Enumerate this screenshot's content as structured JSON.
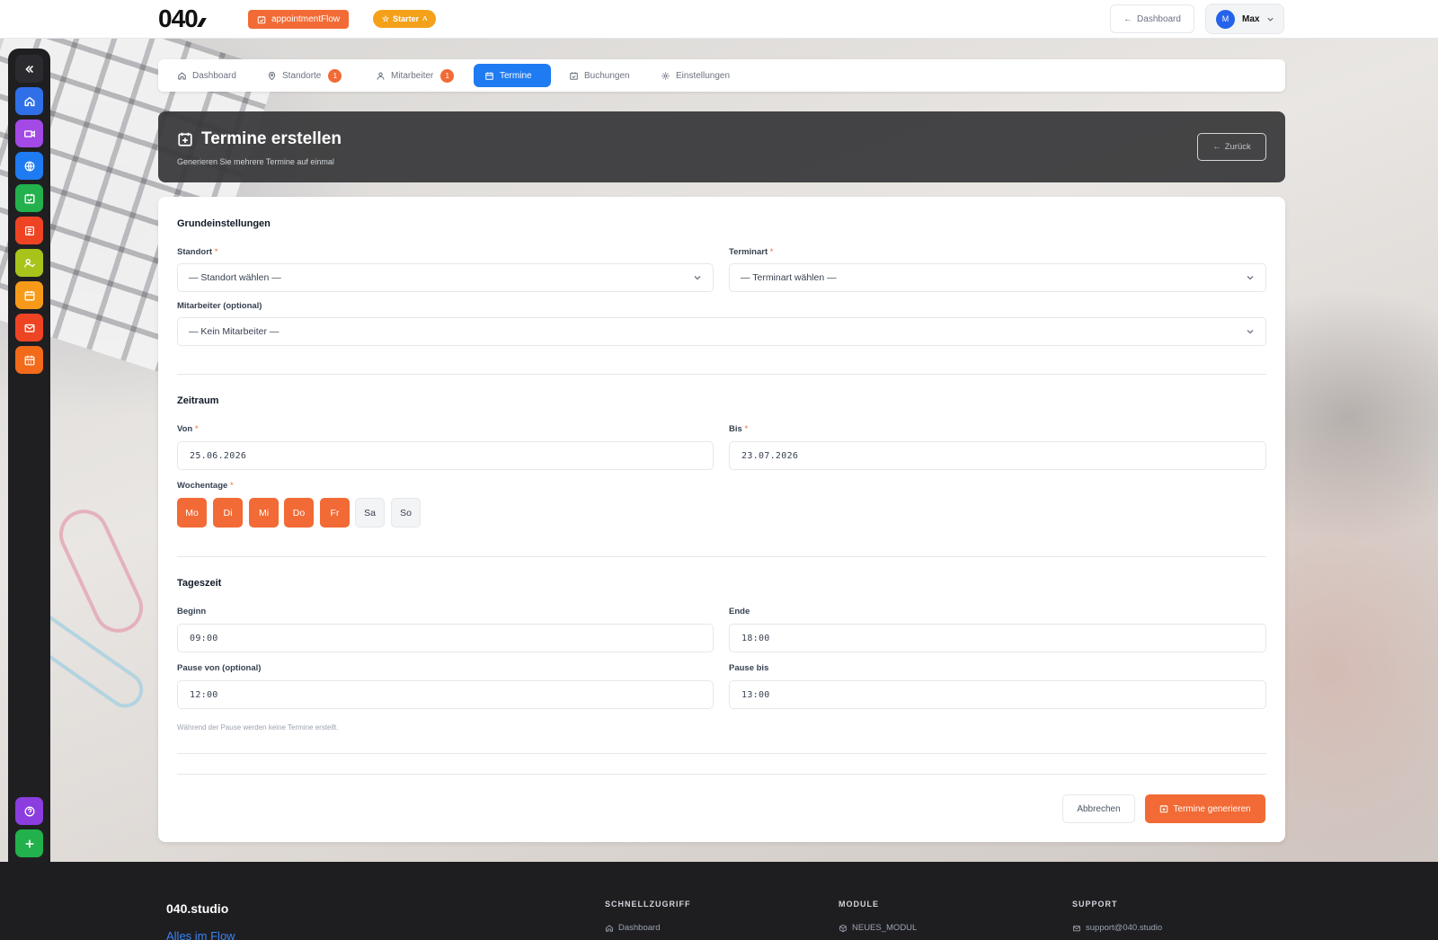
{
  "topbar": {
    "logo": "040",
    "app_badge": "appointmentFlow",
    "plan_badge": "Starter",
    "dashboard_button": "Dashboard",
    "user_initial": "M",
    "user_name": "Max"
  },
  "dock": {
    "items": [
      {
        "icon": "collapse-icon",
        "color": "#1f1f22"
      },
      {
        "icon": "home-icon",
        "color": "#2f6fe8"
      },
      {
        "icon": "video-icon",
        "color": "#a349e6"
      },
      {
        "icon": "globe-icon",
        "color": "#1e7bf2"
      },
      {
        "icon": "calendar-check-icon",
        "color": "#22b14c"
      },
      {
        "icon": "newspaper-icon",
        "color": "#ef4424"
      },
      {
        "icon": "user-check-icon",
        "color": "#a8c41b"
      },
      {
        "icon": "calendar-icon",
        "color": "#f79a1a"
      },
      {
        "icon": "mail-icon",
        "color": "#ef4424"
      },
      {
        "icon": "calendar-grid-icon",
        "color": "#f26a1a"
      }
    ],
    "bottom": [
      {
        "icon": "help-icon",
        "color": "#8b3de0"
      },
      {
        "icon": "plus-icon",
        "color": "#22b14c"
      },
      {
        "icon": "settings-icon",
        "color": "#2f6fe8"
      }
    ]
  },
  "tabs": [
    {
      "label": "Dashboard",
      "icon": "home-icon",
      "count": ""
    },
    {
      "label": "Standorte",
      "icon": "map-pin-icon",
      "count": "1"
    },
    {
      "label": "Mitarbeiter",
      "icon": "user-icon",
      "count": "1"
    },
    {
      "label": "Termine",
      "icon": "calendar-icon",
      "count": "",
      "active": true
    },
    {
      "label": "Buchungen",
      "icon": "calendar-check-icon",
      "count": ""
    },
    {
      "label": "Einstellungen",
      "icon": "gear-icon",
      "count": ""
    }
  ],
  "header": {
    "title": "Termine erstellen",
    "subtitle": "Generieren Sie mehrere Termine auf einmal",
    "back_button": "Zurück"
  },
  "form": {
    "basic": {
      "title": "Grundeinstellungen",
      "location_label": "Standort",
      "location_value": "— Standort wählen —",
      "type_label": "Terminart",
      "type_value": "— Terminart wählen —",
      "staff_label": "Mitarbeiter (optional)",
      "staff_value": "— Kein Mitarbeiter —"
    },
    "period": {
      "title": "Zeitraum",
      "from_label": "Von",
      "from_value": "25.06.2026",
      "to_label": "Bis",
      "to_value": "23.07.2026",
      "weekdays_label": "Wochentage",
      "weekdays": [
        {
          "label": "Mo",
          "selected": true
        },
        {
          "label": "Di",
          "selected": true
        },
        {
          "label": "Mi",
          "selected": true
        },
        {
          "label": "Do",
          "selected": true
        },
        {
          "label": "Fr",
          "selected": true
        },
        {
          "label": "Sa",
          "selected": false
        },
        {
          "label": "So",
          "selected": false
        }
      ]
    },
    "daytime": {
      "title": "Tageszeit",
      "start_label": "Beginn",
      "start_value": "09:00",
      "end_label": "Ende",
      "end_value": "18:00",
      "pause_from_label": "Pause von (optional)",
      "pause_from_value": "12:00",
      "pause_to_label": "Pause bis",
      "pause_to_value": "13:00",
      "hint": "Während der Pause werden keine Termine erstellt."
    },
    "cancel_button": "Abbrechen",
    "generate_button": "Termine generieren",
    "required_mark": "*"
  },
  "footer": {
    "brand": "040.studio",
    "tagline": "Alles im Flow",
    "quick_title": "SCHNELLZUGRIFF",
    "quick_link": "Dashboard",
    "modules_title": "MODULE",
    "modules_link": "NEUES_MODUL",
    "support_title": "SUPPORT",
    "support_link": "support@040.studio"
  },
  "colors": {
    "accent": "#f26a35",
    "primary": "#1e7bf2",
    "plan": "#f4a019"
  }
}
